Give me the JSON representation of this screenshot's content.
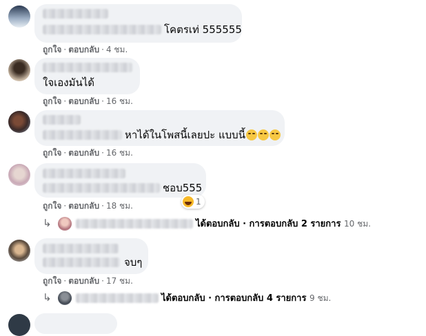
{
  "comments": [
    {
      "text": "โคตรเท่ 555555",
      "time": "4 ชม."
    },
    {
      "text": "ใจเองมันได้",
      "time": "16 ชม."
    },
    {
      "text": "หาได้ในโพสนี้เลยปะ แบบนี้",
      "time": "16 ชม.",
      "emoji": "smiling-emoji"
    },
    {
      "text": "ชอบ555",
      "time": "18 ชม.",
      "reaction_count": "1",
      "replies": {
        "label": "ได้ตอบกลับ · การตอบกลับ 2 รายการ",
        "time": "10 ชม."
      }
    },
    {
      "text": "จบๆ",
      "time": "17 ชม.",
      "replies": {
        "label": "ได้ตอบกลับ · การตอบกลับ 4 รายการ",
        "time": "9 ชม."
      }
    }
  ],
  "actions": {
    "like": "ถูกใจ",
    "reply": "ตอบกลับ",
    "dot": "·"
  },
  "colors": {
    "bubble": "#f0f2f5",
    "meta": "#65676b",
    "text": "#050505"
  }
}
